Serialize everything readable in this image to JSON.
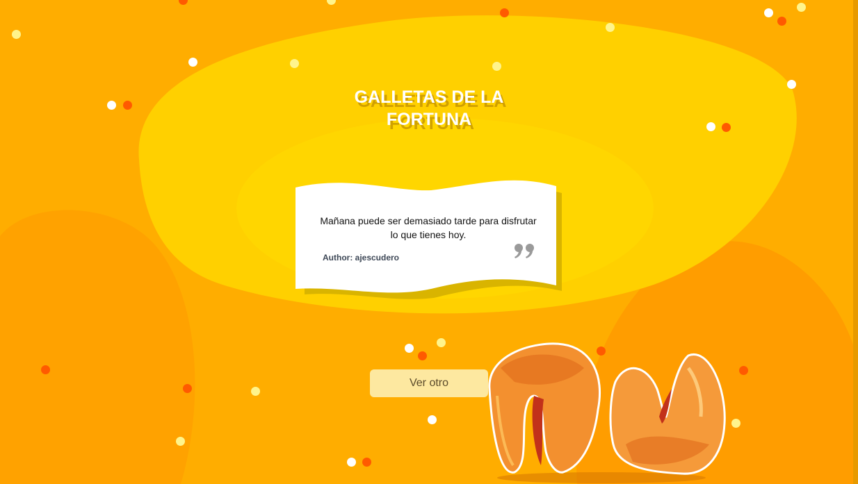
{
  "page": {
    "title": "GALLETAS DE LA FORTUNA",
    "title_line1": "GALLETAS DE LA",
    "title_line2": "FORTUNA"
  },
  "quote_card": {
    "text": "Mañana puede ser demasiado tarde para disfrutar lo que tienes hoy.",
    "author": "Author: ajescudero",
    "icon": "close-quote-icon"
  },
  "actions": {
    "next_label": "Ver otro"
  },
  "decor": {
    "illustration": "fortune-cookies",
    "confetti_colors": [
      "#ffffff",
      "#fff48c",
      "#ff5a00"
    ]
  },
  "colors": {
    "background": "#ffb000",
    "center_blob": "#ffd400",
    "button_bg": "#fde8a0",
    "card_shadow": "#d9b400"
  }
}
